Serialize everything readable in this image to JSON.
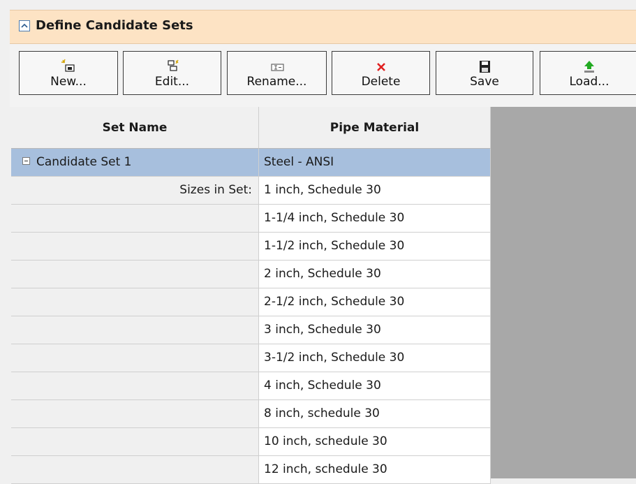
{
  "panel": {
    "title": "Define Candidate Sets"
  },
  "toolbar": {
    "buttons": [
      {
        "label": "New...",
        "icon": "new-set-icon"
      },
      {
        "label": "Edit...",
        "icon": "edit-set-icon"
      },
      {
        "label": "Rename...",
        "icon": "rename-icon"
      },
      {
        "label": "Delete",
        "icon": "delete-x-icon"
      },
      {
        "label": "Save",
        "icon": "floppy-disk-icon"
      },
      {
        "label": "Load...",
        "icon": "load-arrow-icon"
      }
    ]
  },
  "table": {
    "columns": [
      "Set Name",
      "Pipe Material"
    ],
    "set": {
      "name": "Candidate Set 1",
      "material": "Steel - ANSI",
      "sizes_label": "Sizes in Set:",
      "sizes": [
        "1 inch, Schedule 30",
        "1-1/4 inch, Schedule 30",
        "1-1/2 inch, Schedule 30",
        "2 inch, Schedule 30",
        "2-1/2 inch, Schedule 30",
        "3 inch, Schedule 30",
        "3-1/2 inch, Schedule 30",
        "4 inch, Schedule 30",
        "8 inch, schedule 30",
        "10 inch, schedule 30",
        "12 inch, schedule 30"
      ]
    }
  },
  "colors": {
    "title_bg": "#fde3c4",
    "selected_row": "#a7bfdd",
    "empty_area": "#a8a8a8",
    "delete_red": "#e02020",
    "load_green": "#22aa22"
  }
}
